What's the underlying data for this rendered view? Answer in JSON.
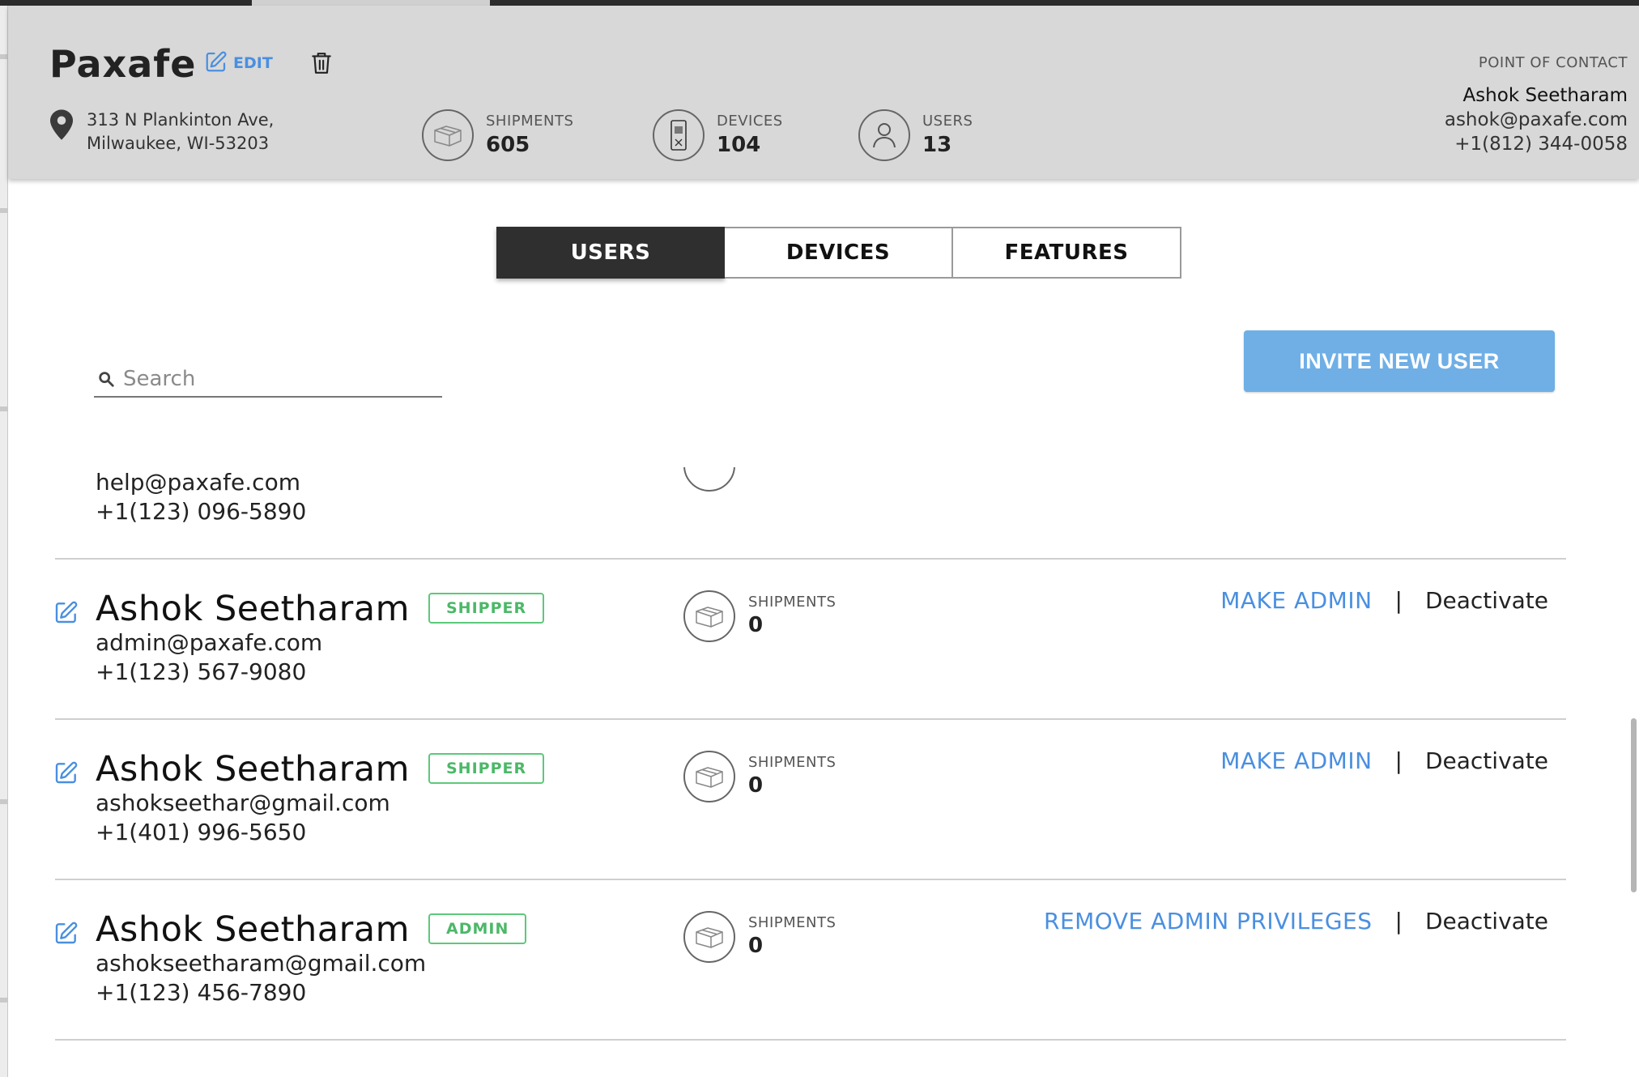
{
  "header": {
    "org_name": "Paxafe",
    "edit_label": "EDIT",
    "address_line1": "313 N Plankinton Ave,",
    "address_line2": "Milwaukee, WI-53203",
    "stats": [
      {
        "label": "SHIPMENTS",
        "value": "605",
        "icon": "package-icon"
      },
      {
        "label": "DEVICES",
        "value": "104",
        "icon": "device-icon"
      },
      {
        "label": "USERS",
        "value": "13",
        "icon": "user-icon"
      }
    ],
    "poc": {
      "title": "POINT OF CONTACT",
      "name": "Ashok Seetharam",
      "email": "ashok@paxafe.com",
      "phone": "+1(812) 344-0058"
    }
  },
  "tabs": [
    {
      "label": "USERS",
      "active": true
    },
    {
      "label": "DEVICES",
      "active": false
    },
    {
      "label": "FEATURES",
      "active": false
    }
  ],
  "search": {
    "placeholder": "Search",
    "value": ""
  },
  "invite_label": "INVITE NEW USER",
  "partial_user": {
    "email": "help@paxafe.com",
    "phone": "+1(123) 096-5890"
  },
  "users": [
    {
      "name": "Ashok Seetharam",
      "role": "SHIPPER",
      "email": "admin@paxafe.com",
      "phone": "+1(123) 567-9080",
      "shipments_label": "SHIPMENTS",
      "shipments": "0",
      "primary_action": "MAKE ADMIN",
      "separator": "|",
      "secondary_action": "Deactivate"
    },
    {
      "name": "Ashok Seetharam",
      "role": "SHIPPER",
      "email": "ashokseethar@gmail.com",
      "phone": "+1(401) 996-5650",
      "shipments_label": "SHIPMENTS",
      "shipments": "0",
      "primary_action": "MAKE ADMIN",
      "separator": "|",
      "secondary_action": "Deactivate"
    },
    {
      "name": "Ashok Seetharam",
      "role": "ADMIN",
      "email": "ashokseetharam@gmail.com",
      "phone": "+1(123) 456-7890",
      "shipments_label": "SHIPMENTS",
      "shipments": "0",
      "primary_action": "REMOVE ADMIN PRIVILEGES",
      "separator": "|",
      "secondary_action": "Deactivate"
    }
  ],
  "colors": {
    "accent_blue": "#4a8fe0",
    "invite_button": "#6fafe6",
    "badge_green": "#4cb868",
    "header_bg": "#d8d8d8",
    "active_tab": "#2f2f2f"
  }
}
